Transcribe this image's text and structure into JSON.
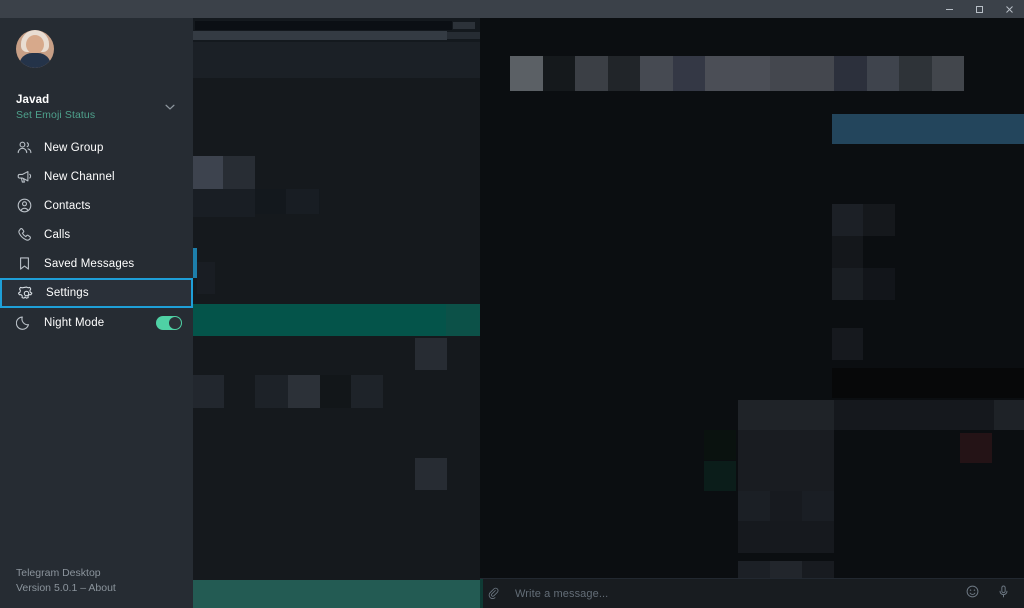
{
  "window": {
    "app_title": "Telegram Desktop",
    "controls": [
      {
        "name": "minimize",
        "glyph": "minimize-icon"
      },
      {
        "name": "maximize",
        "glyph": "maximize-icon"
      },
      {
        "name": "close",
        "glyph": "close-icon"
      }
    ]
  },
  "sidebar": {
    "profile": {
      "name": "Javad",
      "status": "Set Emoji Status",
      "avatar_alt": "avatar",
      "expand_icon": "chevron-down-icon"
    },
    "items": [
      {
        "label": "New Group",
        "icon": "new-group-icon"
      },
      {
        "label": "New Channel",
        "icon": "megaphone-icon"
      },
      {
        "label": "Contacts",
        "icon": "contacts-icon"
      },
      {
        "label": "Calls",
        "icon": "phone-icon"
      },
      {
        "label": "Saved Messages",
        "icon": "bookmark-icon"
      },
      {
        "label": "Settings",
        "icon": "gear-icon"
      },
      {
        "label": "Night Mode",
        "icon": "moon-icon"
      }
    ],
    "selected_item": "Settings",
    "night_mode": {
      "enabled": true,
      "toggle_label": "Night Mode toggle"
    },
    "footer": {
      "line1": "Telegram Desktop",
      "line2": "Version 5.0.1 – About"
    }
  },
  "chat_list": {
    "censored": true,
    "note": "chat list content is pixelated / obscured"
  },
  "chat_panel": {
    "censored": true,
    "note": "conversation content is pixelated / obscured",
    "message_bar": {
      "placeholder": "Write a message...",
      "attach_icon": "paperclip-icon",
      "emoji_icon": "smiley-icon",
      "voice_icon": "microphone-icon"
    }
  },
  "colors": {
    "titlebar": "#3b4149",
    "sidebar_bg": "#262c33",
    "chatlist_bg": "#15191d",
    "chat_bg": "#0b0e11",
    "accent_highlight": "#1e9fd8",
    "accent_green": "#4ea18c",
    "selected_chat_green": "#04544a",
    "toggle_on": "#4fd1a5",
    "bubble_blue": "#23455c"
  }
}
